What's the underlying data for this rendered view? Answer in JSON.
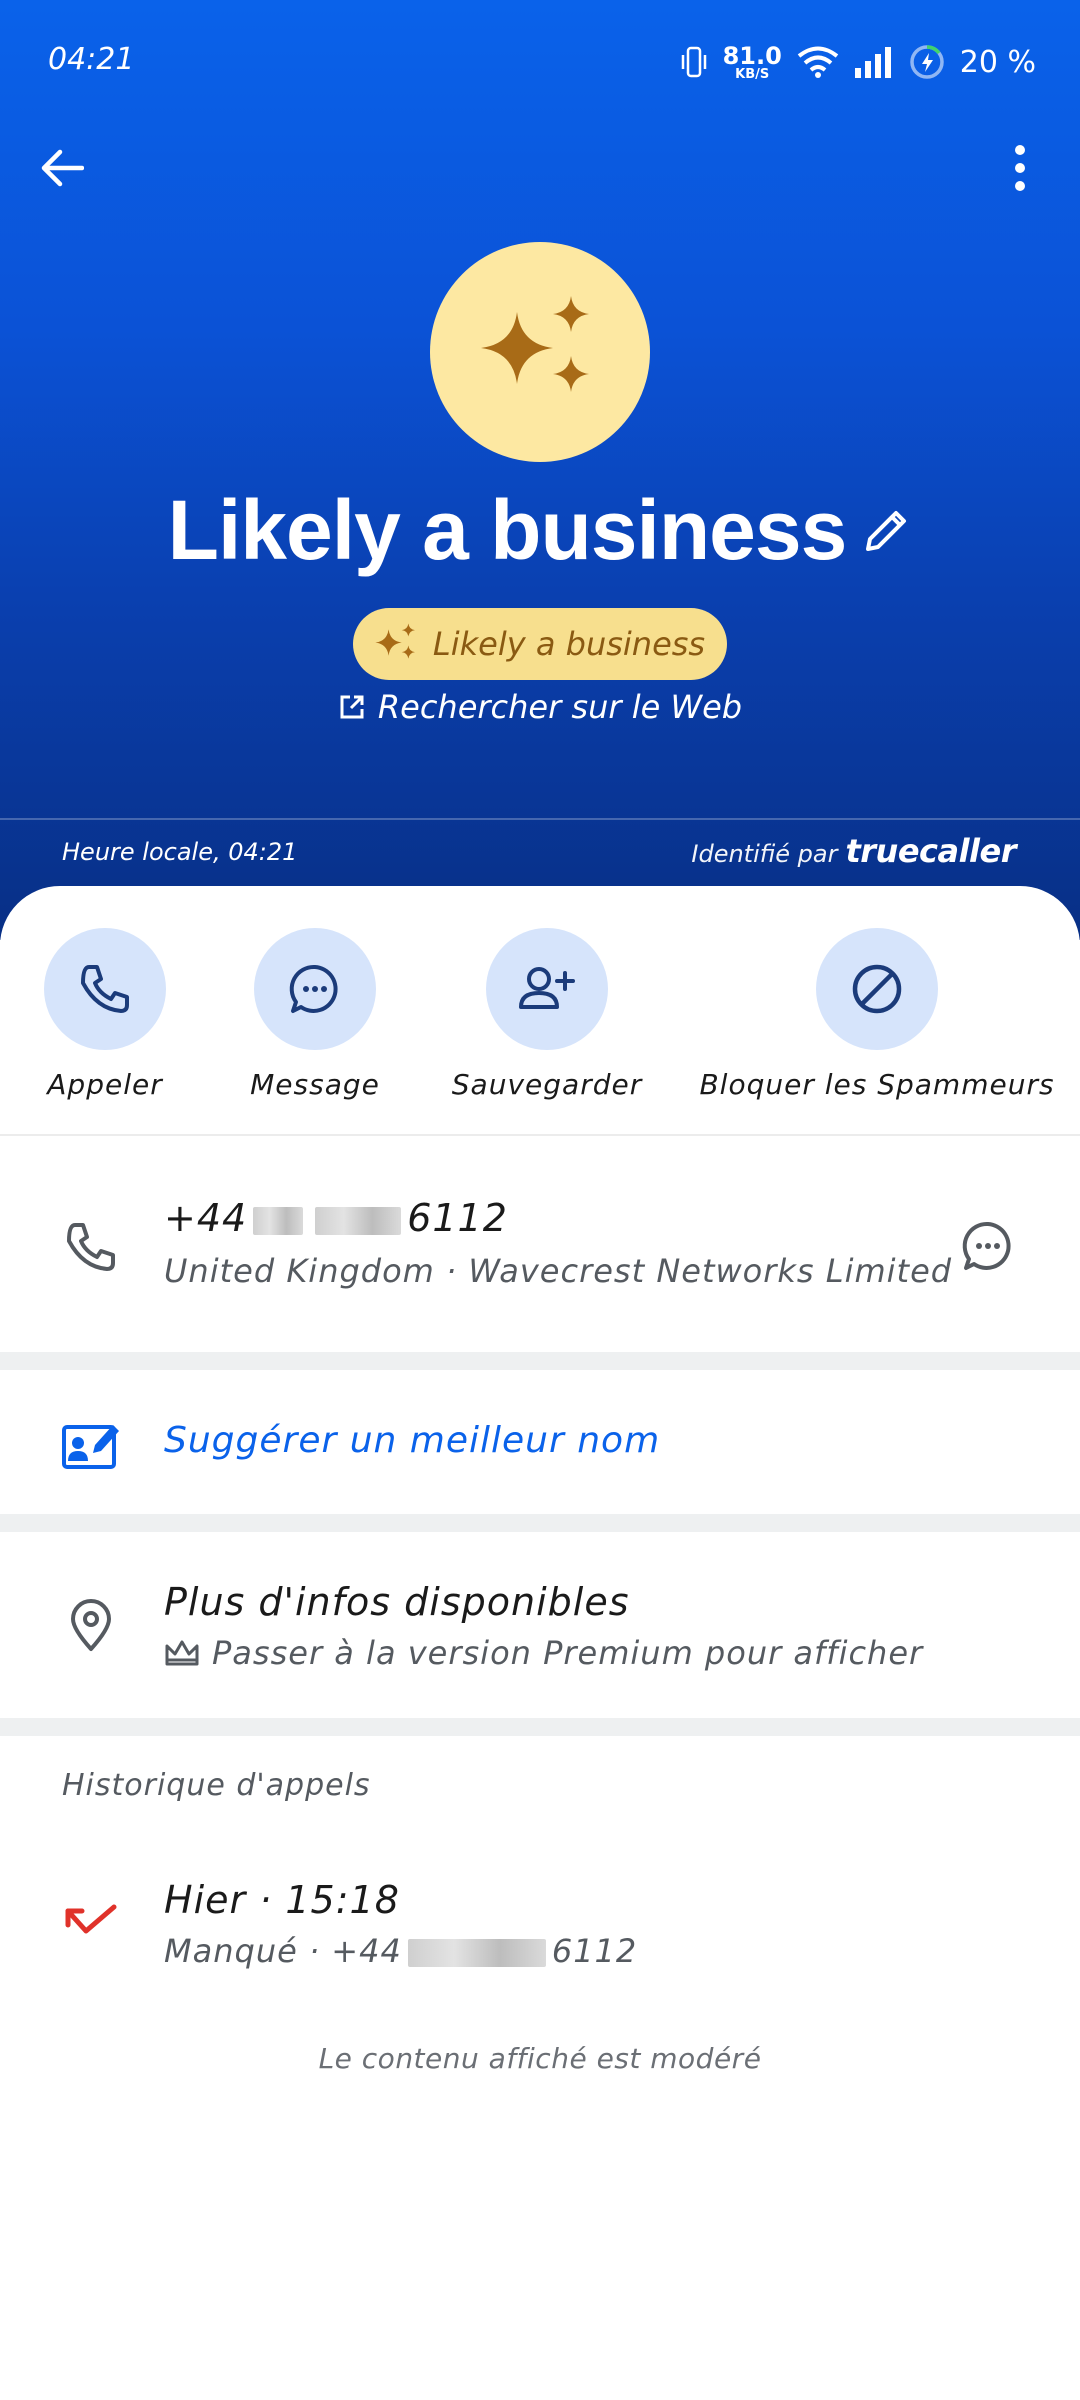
{
  "status_bar": {
    "time": "04:21",
    "net_speed_value": "81.0",
    "net_speed_unit": "KB/S",
    "battery": "20 %"
  },
  "contact": {
    "name": "Likely a business",
    "badge": "Likely a business",
    "web_search": "Rechercher sur le Web",
    "local_time": "Heure locale, 04:21",
    "identified_by": "Identifié par",
    "brand": "truecaller",
    "avatar_color": "#fde8a2",
    "accent_color": "#0a62ea"
  },
  "actions": [
    {
      "label": "Appeler",
      "icon": "phone-icon"
    },
    {
      "label": "Message",
      "icon": "chat-icon"
    },
    {
      "label": "Sauvegarder",
      "icon": "add-person-icon"
    },
    {
      "label": "Bloquer les Spammeurs",
      "icon": "block-icon"
    }
  ],
  "number_row": {
    "prefix": "+44",
    "suffix": "6112",
    "details": "United Kingdom · Wavecrest Networks Limited"
  },
  "suggest": {
    "label": "Suggérer un meilleur nom"
  },
  "more_info": {
    "title": "Plus d'infos disponibles",
    "premium": "Passer à la version Premium pour afficher"
  },
  "call_history": {
    "title": "Historique d'appels",
    "entries": [
      {
        "when": "Hier · 15:18",
        "status": "Manqué · +44",
        "suffix": "6112"
      }
    ]
  },
  "footer_note": "Le contenu affiché est modéré"
}
